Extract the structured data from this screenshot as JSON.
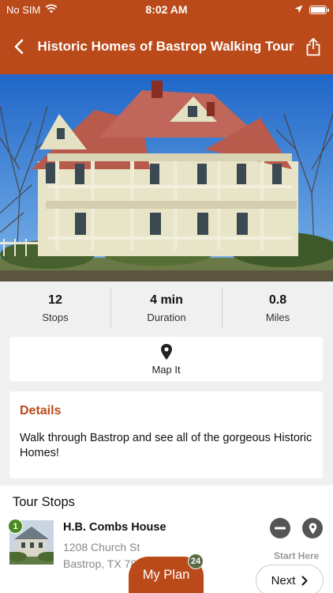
{
  "status_bar": {
    "carrier": "No SIM",
    "time": "8:02 AM"
  },
  "nav": {
    "title": "Historic Homes of Bastrop Walking Tour"
  },
  "stats": [
    {
      "value": "12",
      "label": "Stops"
    },
    {
      "value": "4 min",
      "label": "Duration"
    },
    {
      "value": "0.8",
      "label": "Miles"
    }
  ],
  "map": {
    "label": "Map It"
  },
  "details": {
    "title": "Details",
    "text": "Walk through Bastrop and see all of the gorgeous Historic Homes!"
  },
  "tour_stops": {
    "header": "Tour Stops",
    "items": [
      {
        "number": "1",
        "name": "H.B. Combs House",
        "address_line1": "1208 Church St",
        "address_line2": "Bastrop, TX 78602",
        "start_label": "Start Here"
      }
    ]
  },
  "bottom": {
    "myplan_label": "My Plan",
    "myplan_count": "24",
    "next_label": "Next"
  },
  "colors": {
    "brand": "#ba4a1a",
    "stop_badge": "#4a8a1e",
    "plan_badge": "#5b6b46"
  }
}
